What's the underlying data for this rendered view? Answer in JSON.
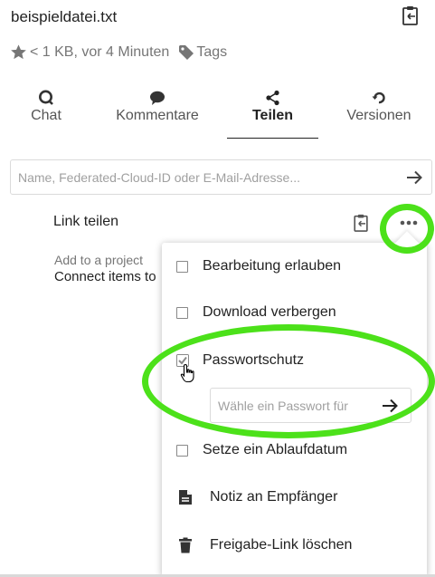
{
  "file": {
    "name": "beispieldatei.txt",
    "size_time": "< 1 KB, vor 4 Minuten",
    "tags_label": "Tags"
  },
  "tabs": [
    {
      "label": "Chat",
      "icon": "chat-icon"
    },
    {
      "label": "Kommentare",
      "icon": "comment-icon"
    },
    {
      "label": "Teilen",
      "icon": "share-icon",
      "active": true
    },
    {
      "label": "Versionen",
      "icon": "history-icon"
    }
  ],
  "share": {
    "placeholder": "Name, Federated-Cloud-ID oder E-Mail-Adresse...",
    "link_label": "Link teilen"
  },
  "project": {
    "label": "Add to a project",
    "description": "Connect items to"
  },
  "menu": {
    "items": [
      {
        "label": "Bearbeitung erlauben",
        "type": "checkbox",
        "checked": false
      },
      {
        "label": "Download verbergen",
        "type": "checkbox",
        "checked": false
      },
      {
        "label": "Passwortschutz",
        "type": "checkbox",
        "checked": true
      },
      {
        "label": "Setze ein Ablaufdatum",
        "type": "checkbox",
        "checked": false
      },
      {
        "label": "Notiz an Empfänger",
        "type": "action",
        "icon": "note-icon"
      },
      {
        "label": "Freigabe-Link löschen",
        "type": "action",
        "icon": "trash-icon"
      }
    ],
    "password_placeholder": "Wähle ein Passwort für"
  },
  "colors": {
    "highlight": "#4ce11a",
    "text": "#222222",
    "muted": "#767676",
    "border": "#dbdbdb"
  }
}
